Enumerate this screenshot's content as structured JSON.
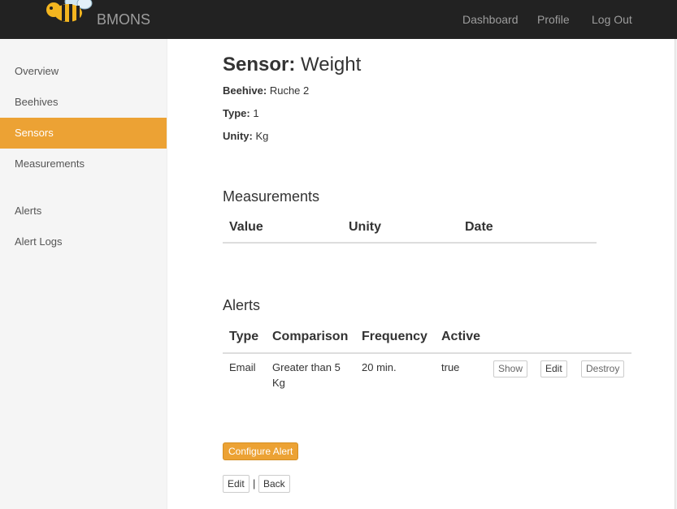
{
  "header": {
    "brand": "BMONS",
    "nav": [
      "Dashboard",
      "Profile",
      "Log Out"
    ]
  },
  "sidebar": {
    "items": [
      {
        "label": "Overview"
      },
      {
        "label": "Beehives"
      },
      {
        "label": "Sensors"
      },
      {
        "label": "Measurements"
      },
      {
        "label": "Alerts"
      },
      {
        "label": "Alert Logs"
      }
    ],
    "active": "Sensors"
  },
  "sensor": {
    "title_prefix": "Sensor:",
    "title_value": "Weight",
    "beehive_label": "Beehive:",
    "beehive_value": "Ruche 2",
    "type_label": "Type:",
    "type_value": "1",
    "unity_label": "Unity:",
    "unity_value": "Kg"
  },
  "measurements": {
    "heading": "Measurements",
    "columns": [
      "Value",
      "Unity",
      "Date"
    ]
  },
  "alerts": {
    "heading": "Alerts",
    "columns": [
      "Type",
      "Comparison",
      "Frequency",
      "Active"
    ],
    "rows": [
      {
        "type": "Email",
        "comparison_line1": "Greater than 5",
        "comparison_line2": "Kg",
        "frequency": "20 min.",
        "active": "true",
        "show": "Show",
        "edit": "Edit",
        "destroy": "Destroy"
      }
    ]
  },
  "actions": {
    "configure_alert": "Configure Alert",
    "edit": "Edit",
    "separator": "|",
    "back": "Back"
  },
  "colors": {
    "accent": "#eca234",
    "navbar": "#222222"
  }
}
